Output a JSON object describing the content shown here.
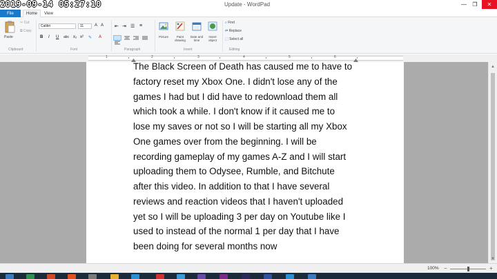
{
  "titlebar": {
    "timestamp": "2019-09-14 05:27:10",
    "title": "Update - WordPad",
    "minimize": "—",
    "maximize": "❐",
    "close": "✕"
  },
  "tabs": {
    "file": "File",
    "home": "Home",
    "view": "View"
  },
  "ribbon": {
    "clipboard": {
      "paste": "Paste",
      "cut": "Cut",
      "copy": "Copy",
      "label": "Clipboard"
    },
    "font": {
      "family": "Calibri",
      "size": "11",
      "label": "Font"
    },
    "paragraph": {
      "label": "Paragraph"
    },
    "insert": {
      "picture": "Picture",
      "paint_line1": "Paint",
      "paint_line2": "drawing",
      "date_line1": "Date and",
      "date_line2": "time",
      "object_line1": "Insert",
      "object_line2": "object",
      "label": "Insert"
    },
    "editing": {
      "find": "Find",
      "replace": "Replace",
      "select_all": "Select all",
      "label": "Editing"
    }
  },
  "ruler": {
    "numbers": [
      "1",
      "2",
      "3",
      "4",
      "5",
      "6"
    ]
  },
  "document": {
    "lines": [
      "The Black Screen of Death has caused me to have to",
      "factory reset my Xbox One. I didn't lose any of the",
      "games I had but I did have to redownload them all",
      "which took a while. I don't know if it caused me to",
      "lose my saves or not so I will be starting all my Xbox",
      "One games over from the beginning. I will be",
      "recording gameplay of my games A-Z and I will start",
      "uploading them to Odysee, Rumble, and Bitchute",
      "after this video. In addition to that I have several",
      "reviews and reaction videos that I haven't uploaded",
      "yet so I will be uploading 3 per day on Youtube like I",
      "used to instead of the normal 1 per day that I have",
      "been doing for several months now"
    ]
  },
  "statusbar": {
    "zoom": "100%",
    "zoom_out": "−",
    "zoom_in": "+"
  },
  "colors": {
    "accent": "#1979ca",
    "close": "#e81123",
    "taskbar": "#1c2b3a"
  }
}
